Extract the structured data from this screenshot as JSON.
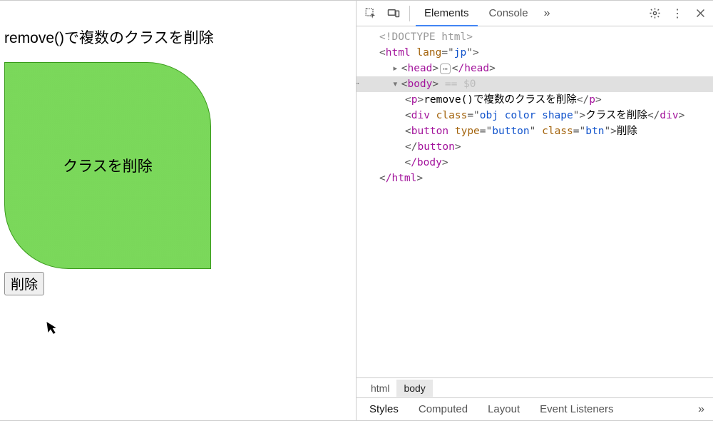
{
  "page": {
    "title": "remove()で複数のクラスを削除",
    "box_text": "クラスを削除",
    "button_label": "削除"
  },
  "devtools": {
    "tabs": {
      "elements": "Elements",
      "console": "Console"
    },
    "more_tabs_glyph": "»",
    "dom": {
      "doctype": "<!DOCTYPE html>",
      "html_open": {
        "tag": "html",
        "attr": "lang",
        "val": "jp"
      },
      "head_open": "head",
      "head_close": "/head",
      "body_open": "body",
      "body_suffix": " == $0",
      "p_tag": "p",
      "p_text": "remove()で複数のクラスを削除",
      "div_tag": "div",
      "div_attr": "class",
      "div_val": "obj color shape",
      "div_text": "クラスを削除",
      "button_tag": "button",
      "button_attr1": "type",
      "button_val1": "button",
      "button_attr2": "class",
      "button_val2": "btn",
      "button_text": "削除",
      "body_close": "/body",
      "html_close": "/html"
    },
    "breadcrumb": {
      "html": "html",
      "body": "body"
    },
    "bottom_tabs": {
      "styles": "Styles",
      "computed": "Computed",
      "layout": "Layout",
      "event_listeners": "Event Listeners",
      "more": "»"
    }
  }
}
